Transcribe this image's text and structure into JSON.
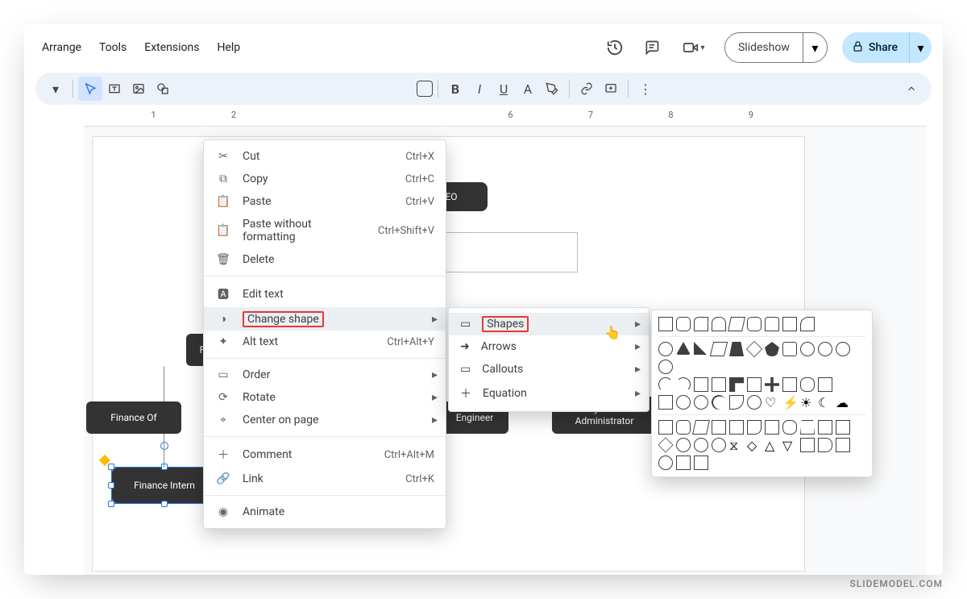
{
  "menubar": {
    "arrange": "Arrange",
    "tools": "Tools",
    "extensions": "Extensions",
    "help": "Help"
  },
  "toolbar_right": {
    "slideshow": "Slideshow",
    "share": "Share"
  },
  "ruler": {
    "n1": "1",
    "n2": "2",
    "n6": "6",
    "n7": "7",
    "n8": "8",
    "n9": "9"
  },
  "nodes": {
    "ceo": "EO",
    "f_col_head": "F",
    "fin_officer": "Finance Of",
    "fin_intern": "Finance Intern",
    "engineer": "Engineer",
    "sysadmin": "System\nAdministrator"
  },
  "ctx": {
    "cut": "Cut",
    "cut_sc": "Ctrl+X",
    "copy": "Copy",
    "copy_sc": "Ctrl+C",
    "paste": "Paste",
    "paste_sc": "Ctrl+V",
    "paste_wf": "Paste without formatting",
    "paste_wf_sc": "Ctrl+Shift+V",
    "delete": "Delete",
    "edit_text": "Edit text",
    "change_shape": "Change shape",
    "alt_text": "Alt text",
    "alt_text_sc": "Ctrl+Alt+Y",
    "order": "Order",
    "rotate": "Rotate",
    "center": "Center on page",
    "comment": "Comment",
    "comment_sc": "Ctrl+Alt+M",
    "link": "Link",
    "link_sc": "Ctrl+K",
    "animate": "Animate"
  },
  "sub": {
    "shapes": "Shapes",
    "arrows": "Arrows",
    "callouts": "Callouts",
    "equation": "Equation"
  },
  "watermark": "SLIDEMODEL.COM"
}
